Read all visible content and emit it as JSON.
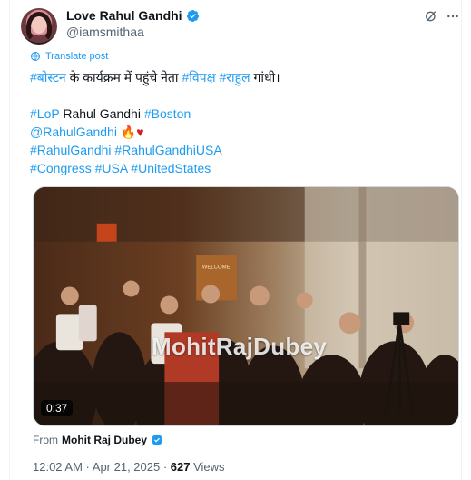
{
  "author": {
    "display_name": "Love Rahul Gandhi",
    "handle": "@iamsmithaa"
  },
  "translate_label": "Translate post",
  "tweet": {
    "line1": {
      "tag1": "#बोस्टन",
      "text1": " के कार्यक्रम में पहुंचे नेता ",
      "tag2": "#विपक्ष",
      "text2": " ",
      "tag3": "#राहुल",
      "text3": " गांधी।"
    },
    "line2": {
      "tag1": "#LoP",
      "text1": " Rahul Gandhi ",
      "tag2": "#Boston"
    },
    "line3": {
      "tag1": "@RahulGandhi",
      "emoji": " 🔥♥"
    },
    "line4": {
      "tag1": "#RahulGandhi",
      "tag2": "#RahulGandhiUSA"
    },
    "line5": {
      "tag1": "#Congress",
      "tag2": "#USA",
      "tag3": "#UnitedStates"
    }
  },
  "media": {
    "duration": "0:37",
    "watermark": "MohitRajDubey",
    "banner_text": "WELCOME"
  },
  "source": {
    "prefix": "From",
    "name": "Mohit Raj Dubey"
  },
  "meta": {
    "time": "12:02 AM",
    "sep1": " · ",
    "date": "Apr 21, 2025",
    "sep2": " · ",
    "views": "627",
    "views_label": " Views"
  },
  "colors": {
    "accent": "#1d9bf0",
    "text": "#0f1419",
    "secondary": "#536471"
  },
  "icons": {
    "verified": "verified-badge-icon",
    "grok": "grok-icon",
    "more": "more-icon",
    "translate": "globe-icon"
  }
}
